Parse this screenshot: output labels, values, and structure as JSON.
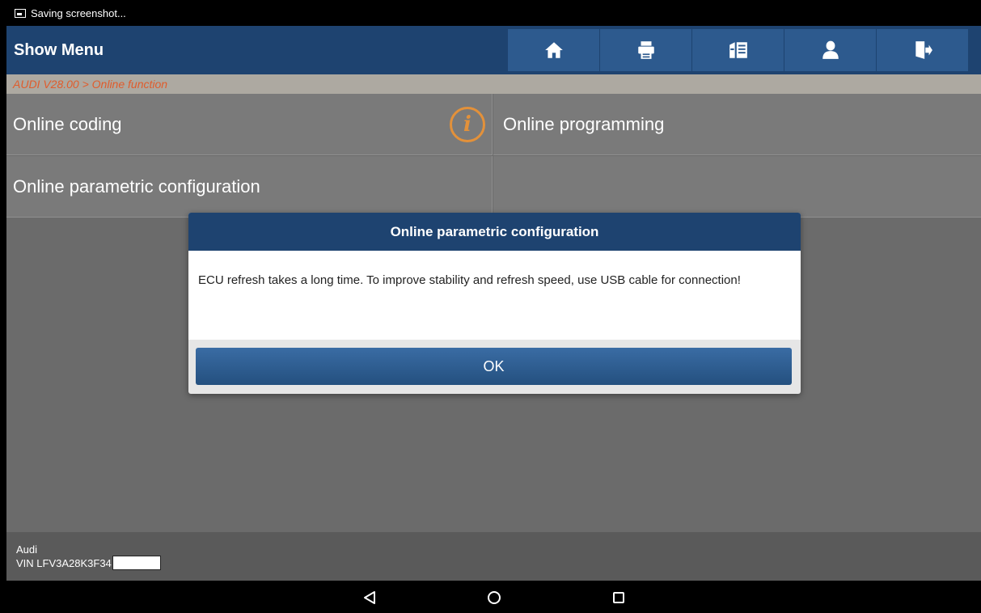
{
  "status_bar": {
    "text": "Saving screenshot..."
  },
  "app_bar": {
    "title": "Show Menu",
    "tools": [
      "home-icon",
      "print-icon",
      "feedback-icon",
      "user-icon",
      "exit-icon"
    ]
  },
  "breadcrumb": {
    "text": "AUDI V28.00 > Online function"
  },
  "menu": {
    "items": [
      {
        "label": "Online coding"
      },
      {
        "label": "Online programming"
      },
      {
        "label": "Online parametric configuration"
      },
      {
        "label": ""
      }
    ]
  },
  "dialog": {
    "title": "Online parametric configuration",
    "message": "ECU refresh takes a long time. To improve stability and refresh speed, use USB cable for connection!",
    "ok_label": "OK"
  },
  "footer": {
    "make": "Audi",
    "vin": "VIN LFV3A28K3F34"
  },
  "colors": {
    "header": "#1e4370",
    "accent": "#e05c2c",
    "info": "#e3913a"
  }
}
